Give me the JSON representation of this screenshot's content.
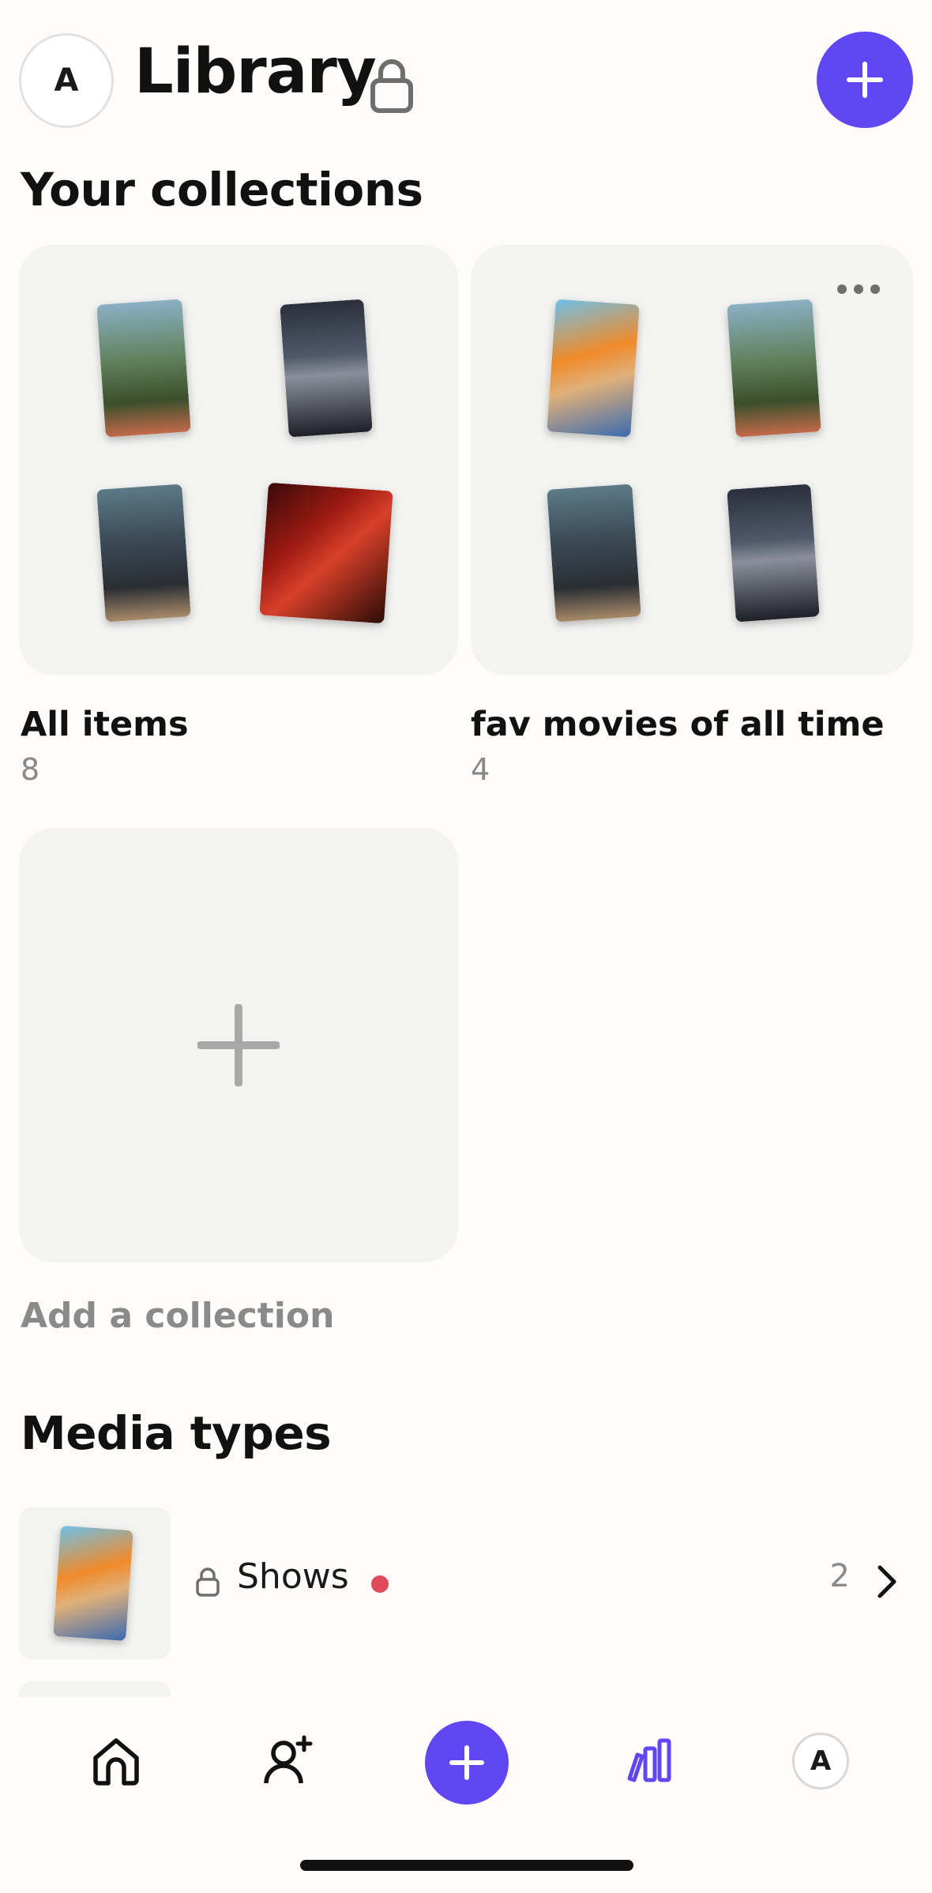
{
  "header": {
    "avatar_initial": "A",
    "title": "Library"
  },
  "collections_section": {
    "title": "Your collections",
    "collections": [
      {
        "name": "All items",
        "count": "8"
      },
      {
        "name": "fav movies of all time",
        "count": "4"
      }
    ],
    "add_label": "Add a collection"
  },
  "media_section": {
    "title": "Media types",
    "items": [
      {
        "label": "Shows",
        "count": "2",
        "has_new": true
      }
    ]
  },
  "tabbar": {
    "profile_initial": "A",
    "active_tab": "library"
  },
  "colors": {
    "accent": "#6146f4",
    "card_bg": "#f3f3f2",
    "badge_red": "#e04a5a",
    "muted_text": "#8a8a8a"
  },
  "icons": [
    "lock-icon",
    "plus-icon",
    "more-icon",
    "chevron-right-icon",
    "home-icon",
    "add-friend-icon",
    "library-icon"
  ]
}
